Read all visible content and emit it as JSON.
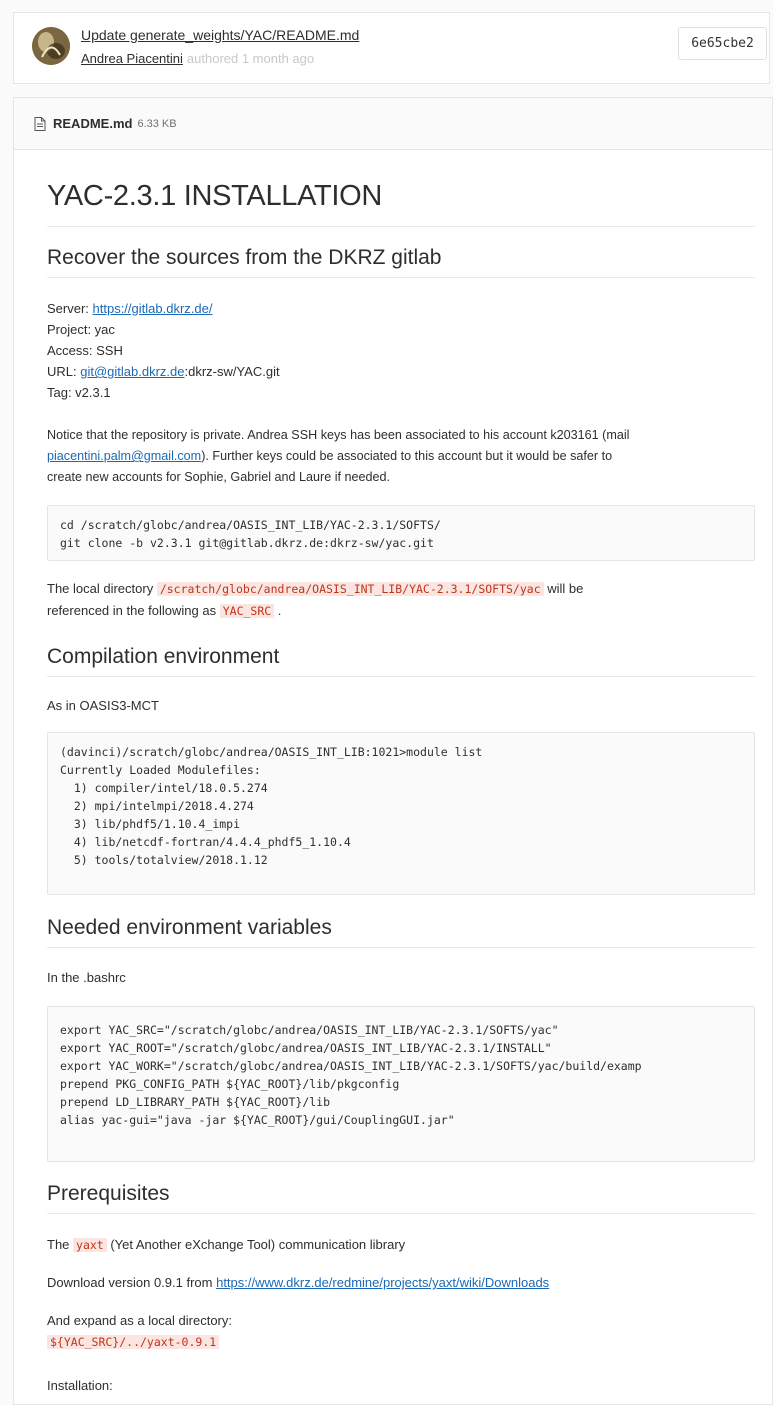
{
  "commit": {
    "title": "Update generate_weights/YAC/README.md",
    "author": "Andrea Piacentini",
    "time": "authored 1 month ago",
    "sha": "6e65cbe2"
  },
  "file": {
    "name": "README.md",
    "size": "6.33 KB"
  },
  "doc": {
    "h1": "YAC-2.3.1 INSTALLATION",
    "sec1": {
      "heading": "Recover the sources from the DKRZ gitlab",
      "server_label": "Server: ",
      "server_link": "https://gitlab.dkrz.de/",
      "project": "Project: yac",
      "access": "Access: SSH",
      "url_label": "URL: ",
      "url_link": "git@gitlab.dkrz.de",
      "url_rest": ":dkrz-sw/YAC.git",
      "tag": "Tag: v2.3.1",
      "notice_1": "Notice that the repository is private. Andrea SSH keys has been associated to his account k203161 (mail",
      "notice_link": "piacentini.palm@gmail.com",
      "notice_2": "). Further keys could be associated to this account but it would be safer to",
      "notice_3": "create new accounts for Sophie, Gabriel and Laure if needed.",
      "code": "cd /scratch/globc/andrea/OASIS_INT_LIB/YAC-2.3.1/SOFTS/\ngit clone -b v2.3.1 git@gitlab.dkrz.de:dkrz-sw/yac.git",
      "local_1": "The local directory ",
      "local_code": "/scratch/globc/andrea/OASIS_INT_LIB/YAC-2.3.1/SOFTS/yac",
      "local_2": " will be",
      "ref_1": "referenced in the following as ",
      "ref_code": "YAC_SRC",
      "ref_2": " ."
    },
    "sec2": {
      "heading": "Compilation environment",
      "text": "As in OASIS3-MCT",
      "code": "(davinci)/scratch/globc/andrea/OASIS_INT_LIB:1021>module list\nCurrently Loaded Modulefiles:\n  1) compiler/intel/18.0.5.274\n  2) mpi/intelmpi/2018.4.274\n  3) lib/phdf5/1.10.4_impi\n  4) lib/netcdf-fortran/4.4.4_phdf5_1.10.4\n  5) tools/totalview/2018.1.12"
    },
    "sec3": {
      "heading": "Needed environment variables",
      "text": "In the .bashrc",
      "code": "export YAC_SRC=\"/scratch/globc/andrea/OASIS_INT_LIB/YAC-2.3.1/SOFTS/yac\"\nexport YAC_ROOT=\"/scratch/globc/andrea/OASIS_INT_LIB/YAC-2.3.1/INSTALL\"\nexport YAC_WORK=\"/scratch/globc/andrea/OASIS_INT_LIB/YAC-2.3.1/SOFTS/yac/build/examp\nprepend PKG_CONFIG_PATH ${YAC_ROOT}/lib/pkgconfig\nprepend LD_LIBRARY_PATH ${YAC_ROOT}/lib\nalias yac-gui=\"java -jar ${YAC_ROOT}/gui/CouplingGUI.jar\""
    },
    "sec4": {
      "heading": "Prerequisites",
      "p1_1": "The ",
      "p1_code": "yaxt",
      "p1_2": " (Yet Another eXchange Tool) communication library",
      "p2_1": "Download version 0.9.1 from ",
      "p2_link": "https://www.dkrz.de/redmine/projects/yaxt/wiki/Downloads",
      "p3": "And expand as a local directory:",
      "p3_code": "${YAC_SRC}/../yaxt-0.9.1",
      "p4": "Installation:"
    }
  }
}
